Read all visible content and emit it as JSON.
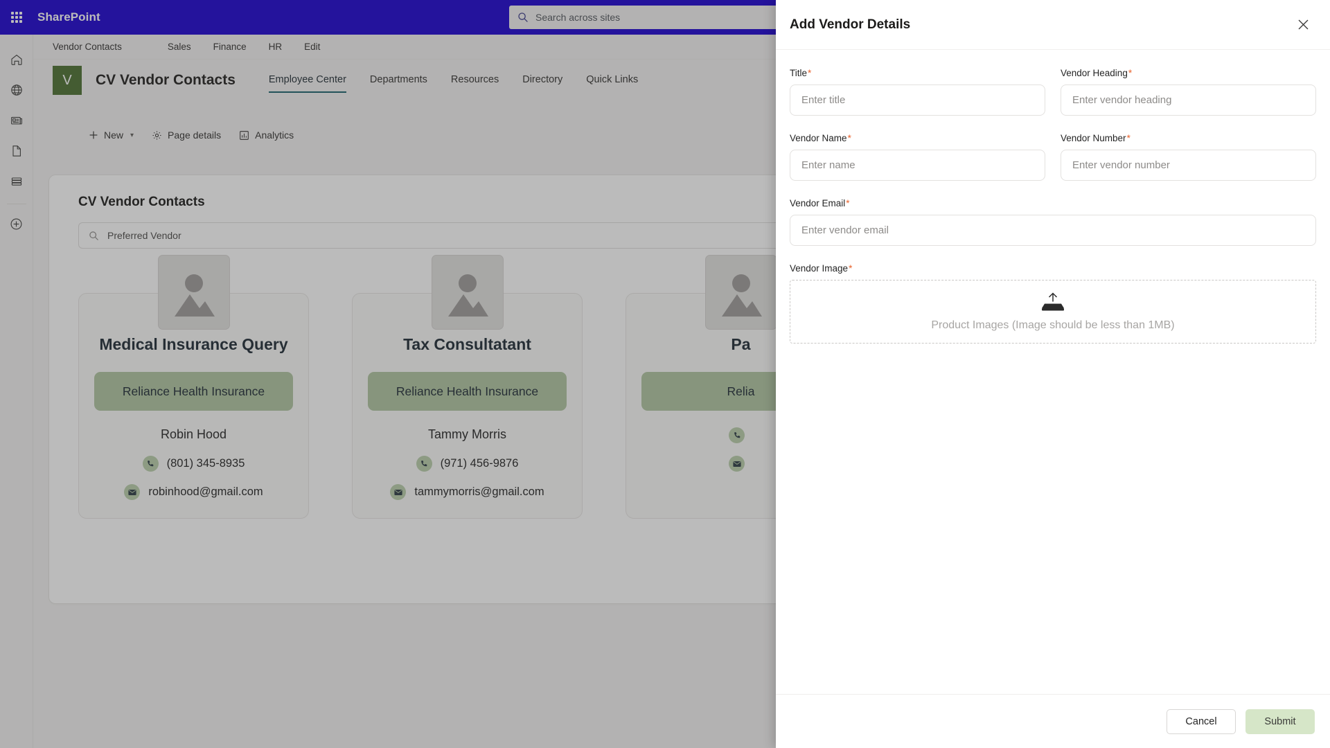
{
  "suite": {
    "waffle_label": "app-launcher",
    "title": "SharePoint",
    "search_placeholder": "Search across sites"
  },
  "rail": {
    "items": [
      {
        "name": "home",
        "label": "Home"
      },
      {
        "name": "globe",
        "label": "My sites"
      },
      {
        "name": "news",
        "label": "News"
      },
      {
        "name": "page",
        "label": "Files"
      },
      {
        "name": "list",
        "label": "Lists"
      },
      {
        "name": "create",
        "label": "Create"
      }
    ]
  },
  "hub": {
    "title": "Vendor Contacts",
    "links": [
      "Sales",
      "Finance",
      "HR",
      "Edit"
    ]
  },
  "site": {
    "logo_letter": "V",
    "name": "CV Vendor Contacts",
    "nav": [
      {
        "label": "Employee Center",
        "active": true
      },
      {
        "label": "Departments",
        "active": false
      },
      {
        "label": "Resources",
        "active": false
      },
      {
        "label": "Directory",
        "active": false
      },
      {
        "label": "Quick Links",
        "active": false
      }
    ]
  },
  "command_bar": {
    "new_label": "New",
    "page_details_label": "Page details",
    "analytics_label": "Analytics"
  },
  "webpart": {
    "title": "CV Vendor Contacts",
    "search_value": "Preferred Vendor",
    "cards": [
      {
        "title": "Medical Insurance Query",
        "badge": "Reliance Health Insurance",
        "person": "Robin Hood",
        "phone": "(801) 345-8935",
        "email": "robinhood@gmail.com"
      },
      {
        "title": "Tax Consultatant",
        "badge": "Reliance Health Insurance",
        "person": "Tammy Morris",
        "phone": "(971) 456-9876",
        "email": "tammymorris@gmail.com"
      },
      {
        "title": "Pa",
        "badge": "Relia",
        "person": "",
        "phone": "",
        "email": ""
      }
    ]
  },
  "panel": {
    "title": "Add Vendor Details",
    "close_label": "Close",
    "fields": {
      "title": {
        "label": "Title",
        "required": true,
        "placeholder": "Enter title",
        "value": ""
      },
      "vendor_heading": {
        "label": "Vendor Heading",
        "required": true,
        "placeholder": "Enter vendor heading",
        "value": ""
      },
      "vendor_name": {
        "label": "Vendor Name",
        "required": true,
        "placeholder": "Enter name",
        "value": ""
      },
      "vendor_number": {
        "label": "Vendor Number",
        "required": true,
        "placeholder": "Enter vendor number",
        "value": ""
      },
      "vendor_email": {
        "label": "Vendor Email",
        "required": true,
        "placeholder": "Enter vendor email",
        "value": ""
      },
      "vendor_image": {
        "label": "Vendor Image",
        "required": true,
        "dropzone_text": "Product Images (Image should be less than 1MB)"
      }
    },
    "buttons": {
      "cancel": "Cancel",
      "submit": "Submit"
    }
  },
  "colors": {
    "suite_bar": "#1a00d0",
    "site_logo": "#4b7030",
    "badge_green": "#b0c5a1",
    "submit_green": "#d6e6c8",
    "required_star": "#e8622c",
    "nav_underline": "#17606b"
  }
}
